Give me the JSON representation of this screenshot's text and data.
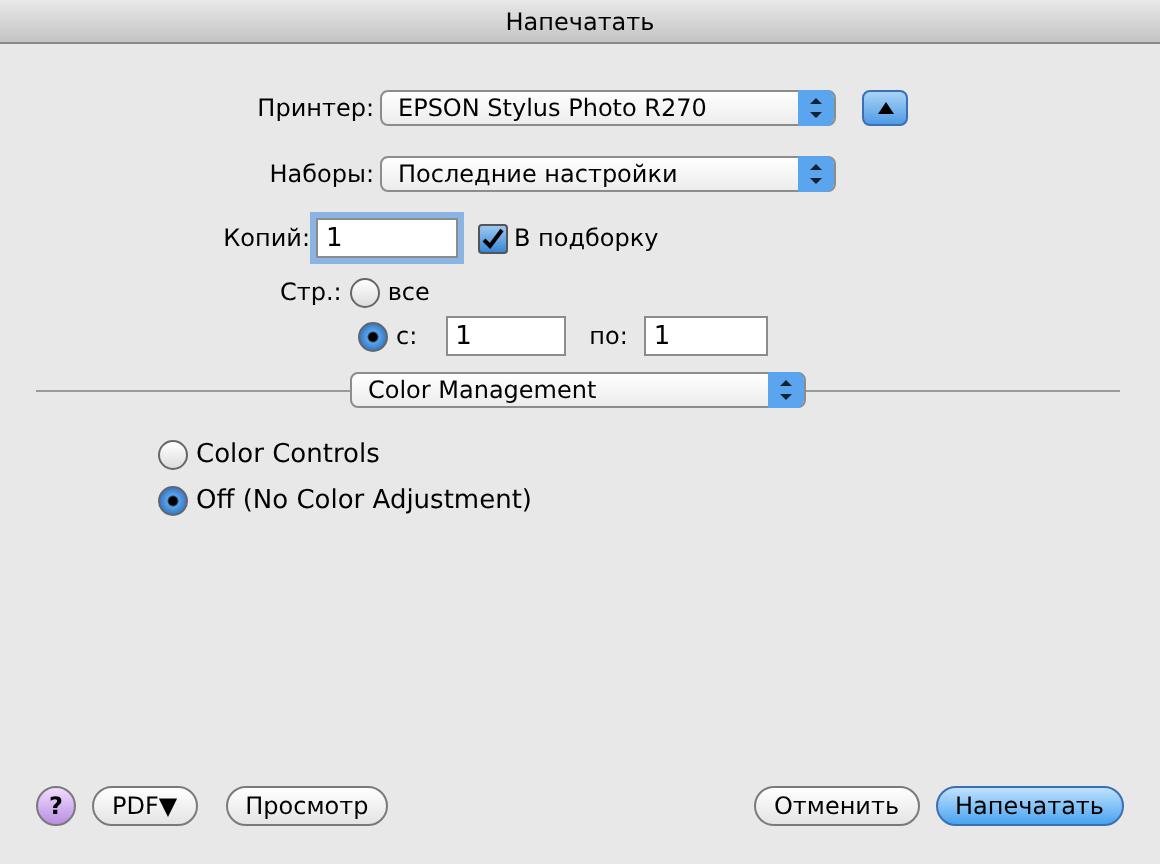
{
  "window": {
    "title": "Напечатать"
  },
  "printer": {
    "label": "Принтер:",
    "value": "EPSON Stylus Photo R270"
  },
  "disclosure": {
    "expanded": true
  },
  "presets": {
    "label": "Наборы:",
    "value": "Последние настройки"
  },
  "copies": {
    "label": "Копий:",
    "value": "1",
    "focused": true
  },
  "collate": {
    "label": "В подборку",
    "checked": true
  },
  "pages": {
    "label": "Стр.:",
    "options": [
      {
        "kind": "all",
        "label": "все",
        "selected": false
      },
      {
        "kind": "range",
        "label": "с:",
        "selected": true,
        "from": "1",
        "to_label": "по:",
        "to": "1"
      }
    ]
  },
  "panel": {
    "value": "Color Management"
  },
  "color_options": [
    {
      "label": "Color Controls",
      "selected": false
    },
    {
      "label": "Off (No Color Adjustment)",
      "selected": true
    }
  ],
  "left_buttons": [
    {
      "kind": "help",
      "label": "?"
    },
    {
      "kind": "plain",
      "label": "PDF▼"
    },
    {
      "kind": "plain",
      "label": "Просмотр"
    }
  ],
  "right_buttons": [
    {
      "label": "Отменить",
      "default": false
    },
    {
      "label": "Напечатать",
      "default": true
    }
  ]
}
